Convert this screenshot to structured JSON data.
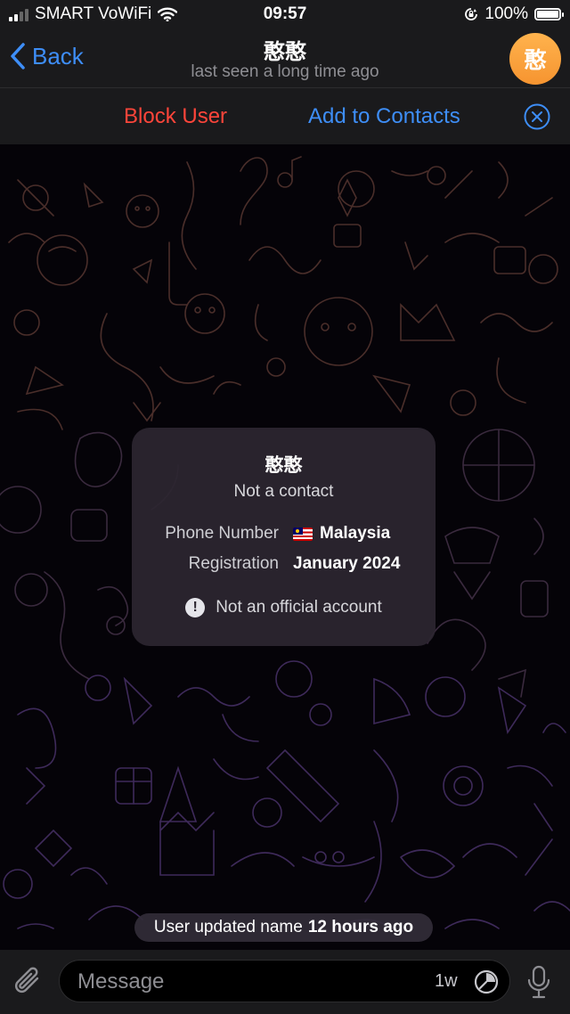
{
  "status_bar": {
    "carrier": "SMART VoWiFi",
    "time": "09:57",
    "battery": "100%",
    "battery_level": 1.0,
    "signal_bars": 2
  },
  "nav": {
    "back_label": "Back",
    "title": "憨憨",
    "subtitle": "last seen a long time ago",
    "avatar_text": "憨",
    "avatar_color": "#f69430"
  },
  "actions": {
    "block_label": "Block User",
    "add_label": "Add to Contacts",
    "block_color": "#ff453a",
    "accent_color": "#3e8ef7"
  },
  "info_card": {
    "name": "憨憨",
    "subtitle": "Not a contact",
    "phone_label": "Phone Number",
    "phone_value": "Malaysia",
    "registration_label": "Registration",
    "registration_value": "January 2024",
    "official_note": "Not an official account"
  },
  "service_message": {
    "text": "User updated name",
    "time": "12 hours ago"
  },
  "input_bar": {
    "placeholder": "Message",
    "timer_label": "1w"
  }
}
